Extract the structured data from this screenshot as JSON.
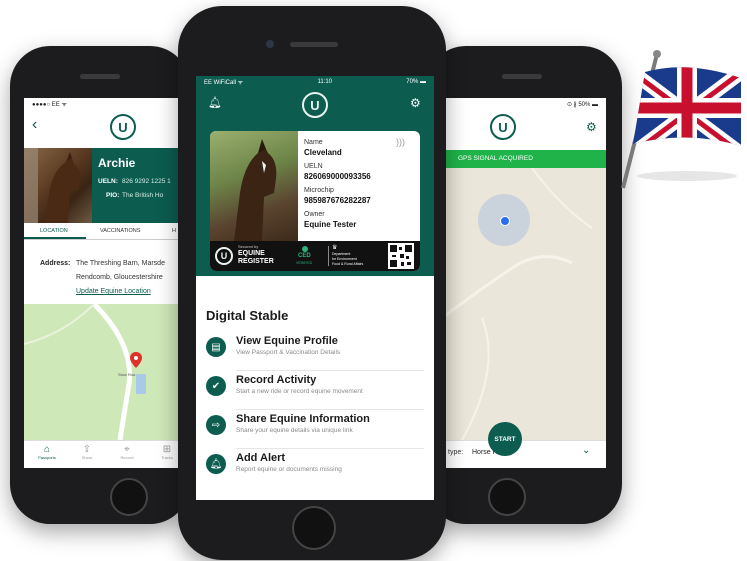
{
  "left_phone": {
    "status": {
      "carrier": "●●●●○ EE ᯤ",
      "time": ""
    },
    "horse": {
      "name": "Archie",
      "ueln_label": "UELN:",
      "ueln_value": "826 9292 1225 1",
      "pio_label": "PIO:",
      "pio_value": "The British Ho"
    },
    "tabs": [
      "LOCATION",
      "VACCINATIONS",
      "H"
    ],
    "address_label": "Address:",
    "address_line1": "The Threshing Barn, Marsde",
    "address_line2": "Rendcomb, Gloucestershire",
    "update_link": "Update Equine Location",
    "map_place": "Stow Roa",
    "bottom_nav": [
      "Passports",
      "Share",
      "Record",
      "Tracks"
    ]
  },
  "center_phone": {
    "status": {
      "carrier": "EE WiFiCall ᯤ",
      "time": "11:10",
      "battery": "70% ▬"
    },
    "passport": {
      "name_label": "Name",
      "name_value": "Cleveland",
      "ueln_label": "UELN",
      "ueln_value": "826069000093356",
      "microchip_label": "Microchip",
      "microchip_value": "985987676282287",
      "owner_label": "Owner",
      "owner_value": "Equine Tester",
      "secured_by": "Secured by",
      "register_line1": "EQUINE",
      "register_line2": "REGISTER",
      "ced_line1": "CED",
      "ced_line2": "VERIFIED",
      "defra_line1": "Department",
      "defra_line2": "for Environment",
      "defra_line3": "Food & Rural Affairs"
    },
    "section_title": "Digital Stable",
    "menu": [
      {
        "title": "View Equine Profile",
        "subtitle": "View Passport & Vaccination Details",
        "icon": "passport-icon"
      },
      {
        "title": "Record Activity",
        "subtitle": "Start a new ride or record equine movement",
        "icon": "check-shield-icon"
      },
      {
        "title": "Share Equine Information",
        "subtitle": "Share your equine details via unique link",
        "icon": "share-icon"
      },
      {
        "title": "Add Alert",
        "subtitle": "Report equine or documents missing",
        "icon": "alert-icon"
      }
    ]
  },
  "right_phone": {
    "status": {
      "time": "",
      "battery": "⊙ ∦ 50% ▬"
    },
    "gps_banner": "GPS SIGNAL ACQUIRED",
    "type_label": "type:",
    "type_value": "Horse Ride",
    "start_button": "START"
  },
  "colors": {
    "teal": "#0c5c50",
    "green_banner": "#1fb34a",
    "map": "#eae6d9",
    "map_green": "#cfe8b8"
  }
}
